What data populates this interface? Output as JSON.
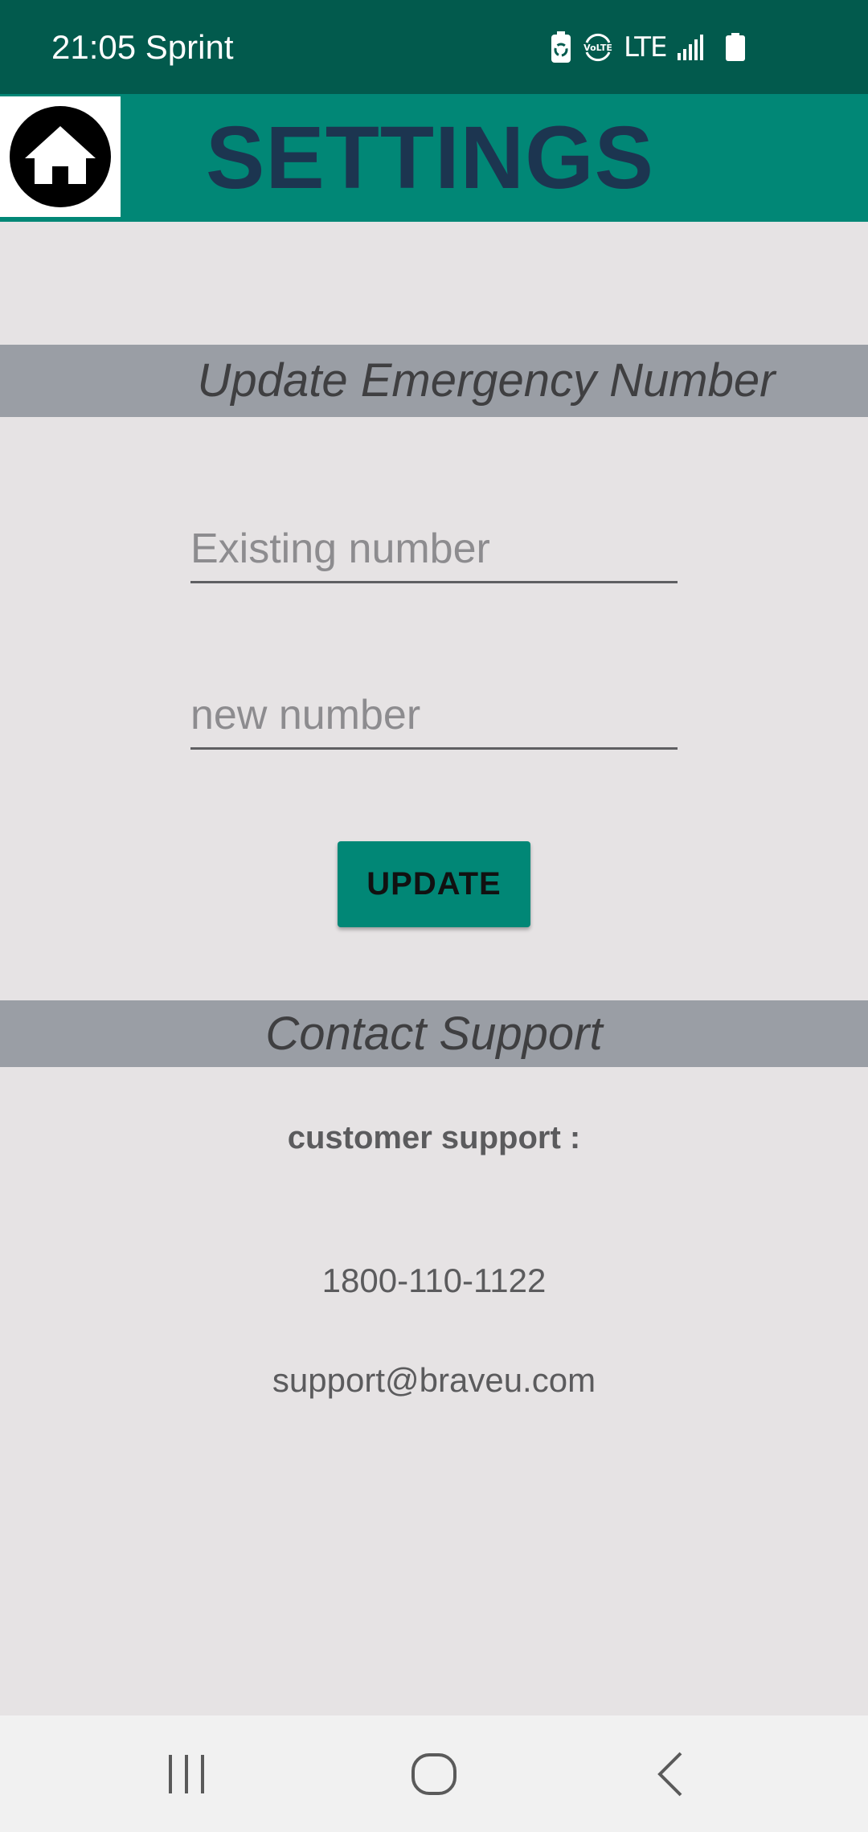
{
  "status_bar": {
    "time": "21:05",
    "carrier": "Sprint",
    "network_label": "LTE",
    "volte_label": "VoLTE"
  },
  "app_bar": {
    "title": "SETTINGS",
    "home_icon": "home-icon"
  },
  "emergency": {
    "header": "Update Emergency Number",
    "existing_placeholder": "Existing number",
    "new_placeholder": "new number",
    "update_label": "UPDATE"
  },
  "support": {
    "header": "Contact Support",
    "label": "customer support :",
    "phone": "1800-110-1122",
    "email": "support@braveu.com"
  },
  "nav_bar": {
    "icons": [
      "recents-icon",
      "home-circle-icon",
      "back-icon"
    ]
  },
  "colors": {
    "status_bar": "#025a4d",
    "app_bar": "#018776",
    "title": "#1c3550",
    "section_header_bg": "#9a9ea5",
    "background": "#e6e3e4",
    "button": "#018776"
  }
}
